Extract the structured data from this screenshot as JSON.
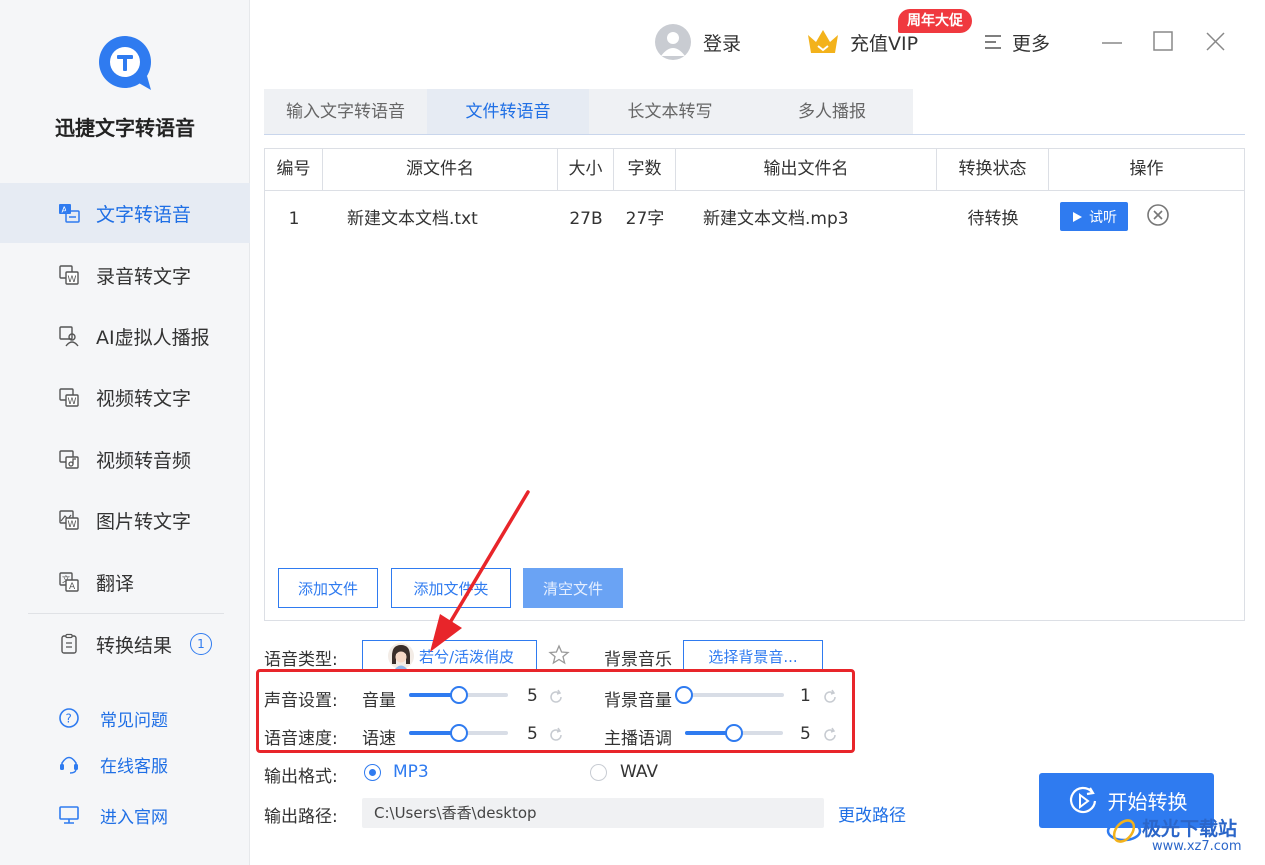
{
  "brand": {
    "name": "迅捷文字转语音",
    "logo_icon": "t-speech-bubble-logo"
  },
  "sidebar": {
    "items": [
      {
        "label": "文字转语音",
        "icon": "text-to-speech-icon",
        "active": true
      },
      {
        "label": "录音转文字",
        "icon": "audio-to-text-icon",
        "active": false
      },
      {
        "label": "AI虚拟人播报",
        "icon": "ai-avatar-icon",
        "active": false
      },
      {
        "label": "视频转文字",
        "icon": "video-to-text-icon",
        "active": false
      },
      {
        "label": "视频转音频",
        "icon": "video-to-audio-icon",
        "active": false
      },
      {
        "label": "图片转文字",
        "icon": "image-to-text-icon",
        "active": false
      },
      {
        "label": "翻译",
        "icon": "translate-icon",
        "active": false
      }
    ],
    "results": {
      "label": "转换结果",
      "count": "1"
    },
    "links": [
      {
        "label": "常见问题",
        "icon": "question-icon"
      },
      {
        "label": "在线客服",
        "icon": "headset-icon"
      },
      {
        "label": "进入官网",
        "icon": "monitor-icon"
      }
    ]
  },
  "topbar": {
    "login_label": "登录",
    "vip_label": "充值VIP",
    "promo_badge": "周年大促",
    "more_label": "更多"
  },
  "tabs": [
    {
      "label": "输入文字转语音",
      "active": false
    },
    {
      "label": "文件转语音",
      "active": true
    },
    {
      "label": "长文本转写",
      "active": false
    },
    {
      "label": "多人播报",
      "active": false
    }
  ],
  "table": {
    "headers": [
      "编号",
      "源文件名",
      "大小",
      "字数",
      "输出文件名",
      "转换状态",
      "操作"
    ],
    "rows": [
      {
        "index": "1",
        "source": "新建文本文档.txt",
        "size": "27B",
        "chars": "27字",
        "output": "新建文本文档.mp3",
        "status": "待转换",
        "preview_label": "试听"
      }
    ],
    "buttons": {
      "add_file": "添加文件",
      "add_folder": "添加文件夹",
      "clear": "清空文件"
    }
  },
  "settings": {
    "voice_type_label": "语音类型:",
    "voice_name": "若兮/活泼俏皮",
    "bgm_label": "背景音乐",
    "bgm_button": "选择背景音...",
    "sound_label": "声音设置:",
    "speed_label": "语音速度:",
    "volume": {
      "label": "音量",
      "value": "5",
      "fraction": 0.5
    },
    "bg_volume": {
      "label": "背景音量",
      "value": "1",
      "fraction": 0.0
    },
    "speed": {
      "label": "语速",
      "value": "5",
      "fraction": 0.5
    },
    "pitch": {
      "label": "主播语调",
      "value": "5",
      "fraction": 0.5
    },
    "format_label": "输出格式:",
    "format_options": [
      {
        "label": "MP3",
        "selected": true
      },
      {
        "label": "WAV",
        "selected": false
      }
    ],
    "path_label": "输出路径:",
    "path_value": "C:\\Users\\香香\\desktop",
    "change_path": "更改路径"
  },
  "start_button": "开始转换",
  "watermark": {
    "brand": "极光下载站",
    "url": "www.xz7.com"
  },
  "colors": {
    "accent": "#2f7bf0",
    "highlight": "#e8252a",
    "promo": "#f0393f",
    "vip_gold": "#f3b21b"
  }
}
